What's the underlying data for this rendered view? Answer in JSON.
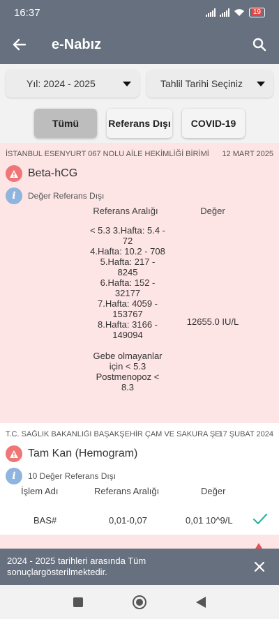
{
  "status_bar": {
    "time": "16:37",
    "battery": "19"
  },
  "app_bar": {
    "title": "e-Nabız"
  },
  "filters": {
    "year": "Yıl: 2024 - 2025",
    "date": "Tahlil Tarihi Seçiniz"
  },
  "chips": [
    "Tümü",
    "Referans Dışı",
    "COVID-19"
  ],
  "results": [
    {
      "institution": "İSTANBUL ESENYURT 067 NOLU AİLE HEKİMLİĞİ BİRİMİ",
      "date": "12 MART 2025",
      "test_name": "Beta-hCG",
      "info": "Değer Referans Dışı",
      "col_range": "Referans Aralığı",
      "col_value": "Değer",
      "range_text": "< 5.3  3.Hafta: 5.4 -\n72\n4.Hafta: 10.2 - 708\n5.Hafta: 217 -\n8245\n6.Hafta: 152 -\n32177\n7.Hafta: 4059 -\n153767\n8.Hafta: 3166 -\n149094\n\nGebe olmayanlar\niçin < 5.3\nPostmenopoz   <\n8.3",
      "value": "12655.0 IU/L"
    },
    {
      "institution": "T.C. SAĞLIK BAKANLIĞI BAŞAKŞEHİR ÇAM VE SAKURA ŞEHİR HASTANESİ",
      "date": "17 ŞUBAT 2024",
      "test_name": "Tam Kan (Hemogram)",
      "info": "10 Değer Referans Dışı",
      "col_name": "İşlem Adı",
      "col_range": "Referans Aralığı",
      "col_value": "Değer",
      "rows": [
        {
          "name": "BAS#",
          "range": "0,01-0,07",
          "value": "0,01 10^9/L"
        }
      ]
    }
  ],
  "snackbar": {
    "message": "2024 - 2025 tarihleri arasında Tüm sonuçlargösterilmektedir."
  },
  "colors": {
    "primary": "#66707f",
    "out_of_range_bg": "#fde4e5",
    "warning": "#f07575",
    "info": "#8fb4dd",
    "check": "#2bb3a3"
  }
}
